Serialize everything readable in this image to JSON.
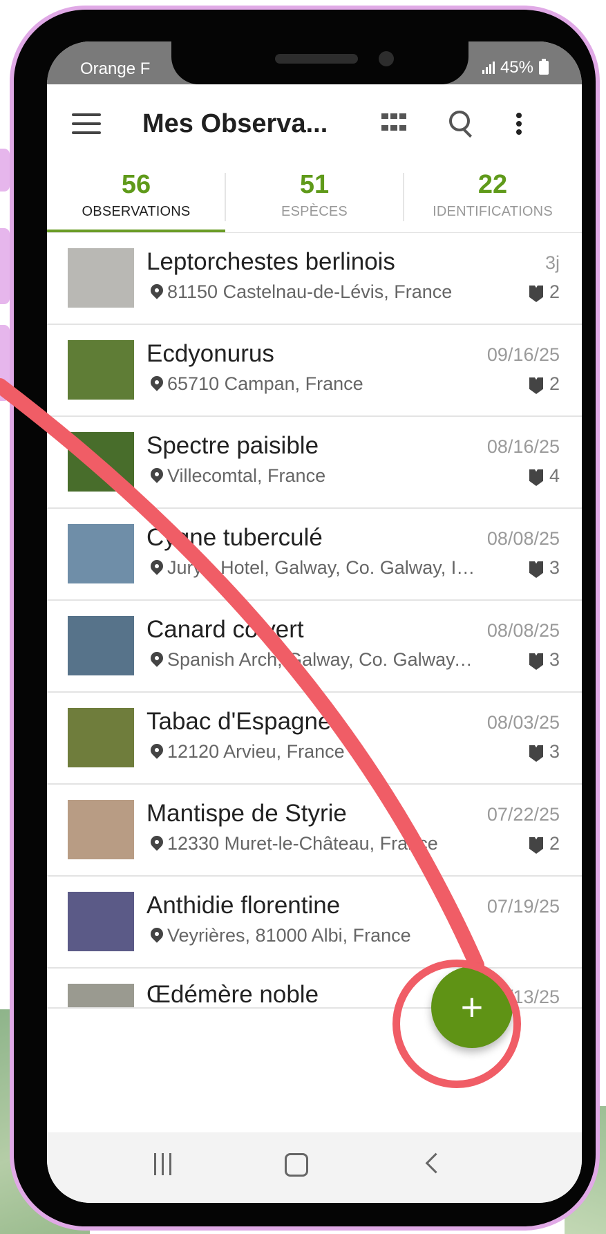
{
  "status": {
    "carrier": "Orange F",
    "battery": "45%"
  },
  "header": {
    "title": "Mes Observa..."
  },
  "tabs": [
    {
      "count": "56",
      "label": "OBSERVATIONS"
    },
    {
      "count": "51",
      "label": "ESPÈCES"
    },
    {
      "count": "22",
      "label": "IDENTIFICATIONS"
    }
  ],
  "observations": [
    {
      "name": "Leptorchestes berlinois",
      "date": "3j",
      "place": "81150 Castelnau-de-Lévis, France",
      "ids": "2",
      "thumb_color": "#b9b8b4"
    },
    {
      "name": "Ecdyonurus",
      "date": "09/16/25",
      "place": "65710 Campan, France",
      "ids": "2",
      "thumb_color": "#5f7d36"
    },
    {
      "name": "Spectre paisible",
      "date": "08/16/25",
      "place": "Villecomtal, France",
      "ids": "4",
      "thumb_color": "#486d2b"
    },
    {
      "name": "Cygne tuberculé",
      "date": "08/08/25",
      "place": "Jury's Hotel, Galway, Co. Galway, Irl...",
      "ids": "3",
      "thumb_color": "#6f8ea8"
    },
    {
      "name": "Canard colvert",
      "date": "08/08/25",
      "place": "Spanish Arch, Galway, Co. Galway, ...",
      "ids": "3",
      "thumb_color": "#57738a"
    },
    {
      "name": "Tabac d'Espagne",
      "date": "08/03/25",
      "place": "12120 Arvieu, France",
      "ids": "3",
      "thumb_color": "#6f7d3c"
    },
    {
      "name": "Mantispe de Styrie",
      "date": "07/22/25",
      "place": "12330 Muret-le-Château, France",
      "ids": "2",
      "thumb_color": "#b89c84"
    },
    {
      "name": "Anthidie florentine",
      "date": "07/19/25",
      "place": "Veyrières, 81000 Albi, France",
      "ids": "",
      "thumb_color": "#5b5a87"
    },
    {
      "name": "Œdémère noble",
      "date": "05/13/25",
      "place": "",
      "ids": "",
      "thumb_color": "#9a9a90"
    }
  ],
  "fab": {
    "label": "+"
  },
  "colors": {
    "accent": "#5f9315",
    "highlight": "#f05d66",
    "frame": "#e0a9e6"
  }
}
